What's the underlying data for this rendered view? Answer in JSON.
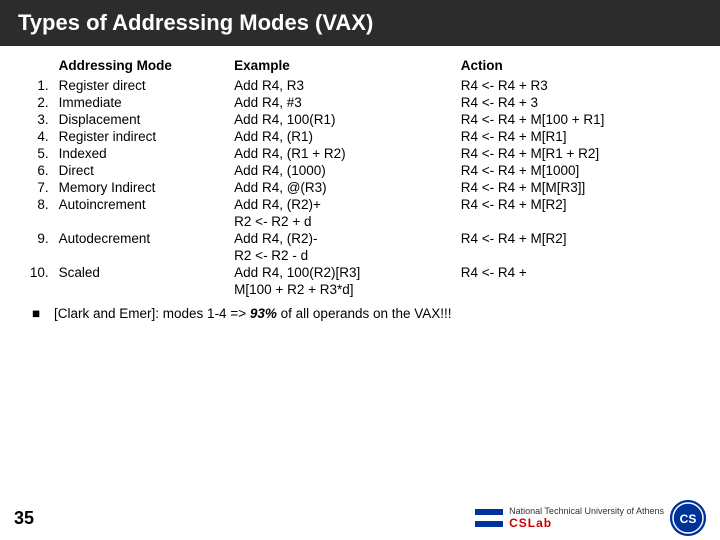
{
  "title": "Types of Addressing Modes (VAX)",
  "table": {
    "headers": [
      "",
      "Addressing Mode",
      "Example",
      "Action"
    ],
    "rows": [
      {
        "num": "1.",
        "mode": "Register direct",
        "example": "Add R4, R3",
        "action": "R4 <- R4 + R3"
      },
      {
        "num": "2.",
        "mode": "Immediate",
        "example": "Add R4, #3",
        "action": "R4 <- R4 + 3"
      },
      {
        "num": "3.",
        "mode": "Displacement",
        "example": "Add R4, 100(R1)",
        "action": "R4 <- R4 + M[100 + R1]"
      },
      {
        "num": "4.",
        "mode": "Register indirect",
        "example": "Add R4, (R1)",
        "action": "R4 <- R4 + M[R1]"
      },
      {
        "num": "5.",
        "mode": "Indexed",
        "example": "Add R4, (R1 + R2)",
        "action": "R4 <- R4 + M[R1 + R2]"
      },
      {
        "num": "6.",
        "mode": "Direct",
        "example": "Add R4, (1000)",
        "action": "R4 <- R4 + M[1000]"
      },
      {
        "num": "7.",
        "mode": "Memory Indirect",
        "example": "Add R4, @(R3)",
        "action": "R4 <- R4 + M[M[R3]]"
      },
      {
        "num": "8.",
        "mode": "Autoincrement",
        "example": "Add R4, (R2)+",
        "action": "R4 <- R4 + M[R2]"
      },
      {
        "num": "",
        "mode": "",
        "example": "R2 <- R2 + d",
        "action": ""
      },
      {
        "num": "9.",
        "mode": "Autodecrement",
        "example": "Add R4, (R2)-",
        "action": "R4 <- R4 + M[R2]"
      },
      {
        "num": "",
        "mode": "",
        "example": "R2 <- R2 - d",
        "action": ""
      },
      {
        "num": "10.",
        "mode": "Scaled",
        "example": "Add R4, 100(R2)[R3]",
        "action": "R4 <- R4 +"
      },
      {
        "num": "",
        "mode": "",
        "example": "M[100 + R2 + R3*d]",
        "action": ""
      }
    ],
    "note_bullet": "■",
    "note_text": "[Clark and Emer]: modes 1-4 =>",
    "note_bold": "93%",
    "note_suffix": "of all operands on the VAX!!!"
  },
  "footer": {
    "page": "35",
    "logo_circle_text": "CS",
    "org_line1": "National Technical University of Athens",
    "org_line2": "CSLab"
  }
}
